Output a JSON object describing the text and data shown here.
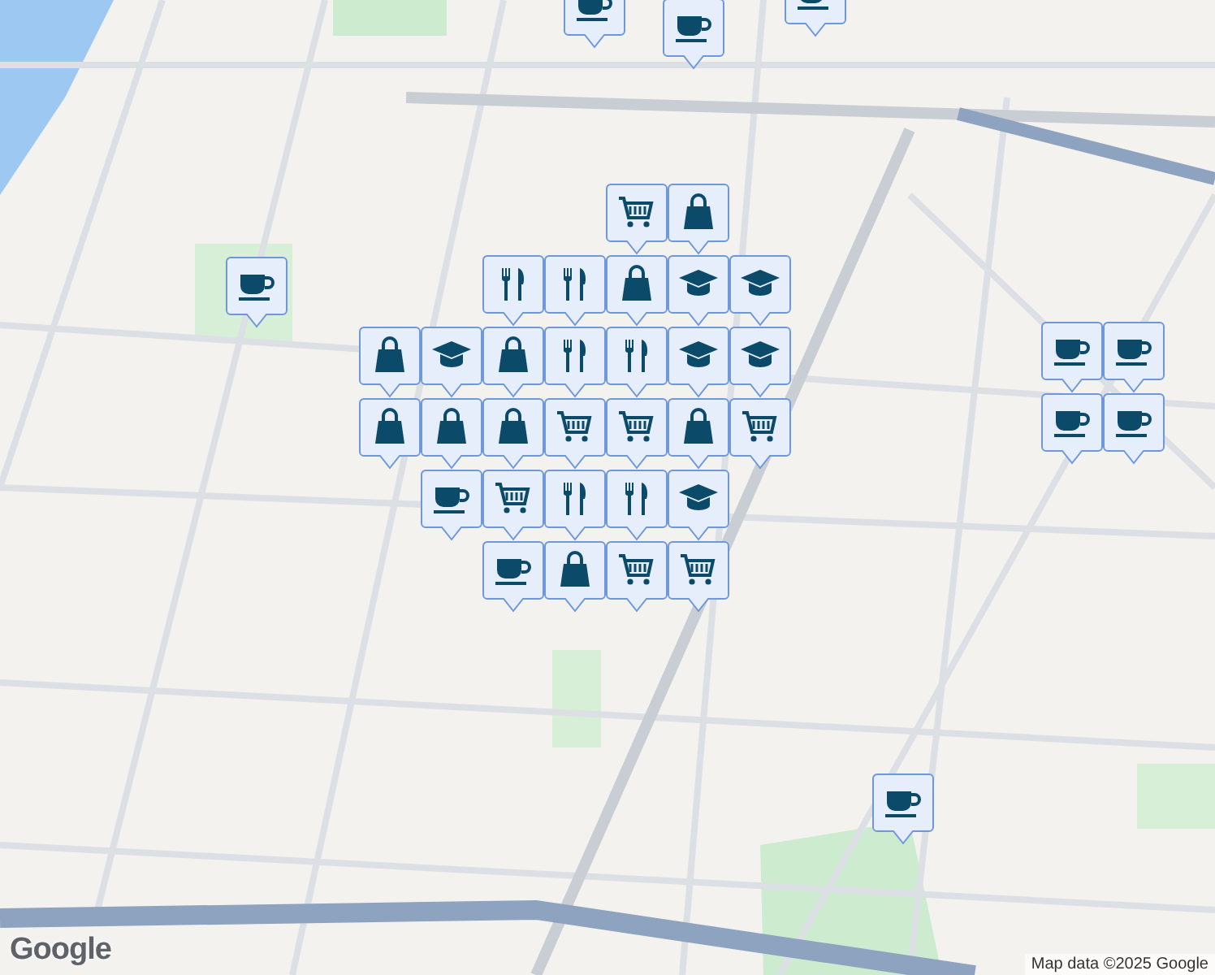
{
  "map": {
    "markers": [
      {
        "kind": "coffee"
      },
      {
        "kind": "coffee"
      },
      {
        "kind": "coffee"
      },
      {
        "kind": "coffee"
      },
      {
        "kind": "bag"
      },
      {
        "kind": "cart"
      },
      {
        "kind": "bag"
      },
      {
        "kind": "school"
      },
      {
        "kind": "school"
      },
      {
        "kind": "restaurant"
      },
      {
        "kind": "restaurant"
      },
      {
        "kind": "restaurant"
      },
      {
        "kind": "restaurant"
      },
      {
        "kind": "bag"
      },
      {
        "kind": "school"
      },
      {
        "kind": "bag"
      },
      {
        "kind": "bag"
      },
      {
        "kind": "school"
      },
      {
        "kind": "cart"
      },
      {
        "kind": "bag"
      },
      {
        "kind": "school"
      },
      {
        "kind": "cart"
      },
      {
        "kind": "cart"
      },
      {
        "kind": "coffee"
      },
      {
        "kind": "coffee"
      },
      {
        "kind": "coffee"
      },
      {
        "kind": "coffee"
      },
      {
        "kind": "bag"
      },
      {
        "kind": "bag"
      },
      {
        "kind": "coffee"
      },
      {
        "kind": "cart"
      },
      {
        "kind": "restaurant"
      },
      {
        "kind": "restaurant"
      },
      {
        "kind": "school"
      },
      {
        "kind": "coffee"
      },
      {
        "kind": "bag"
      },
      {
        "kind": "cart"
      },
      {
        "kind": "cart"
      },
      {
        "kind": "coffee"
      }
    ]
  },
  "logo": "Google",
  "attribution": "Map data ©2025 Google"
}
